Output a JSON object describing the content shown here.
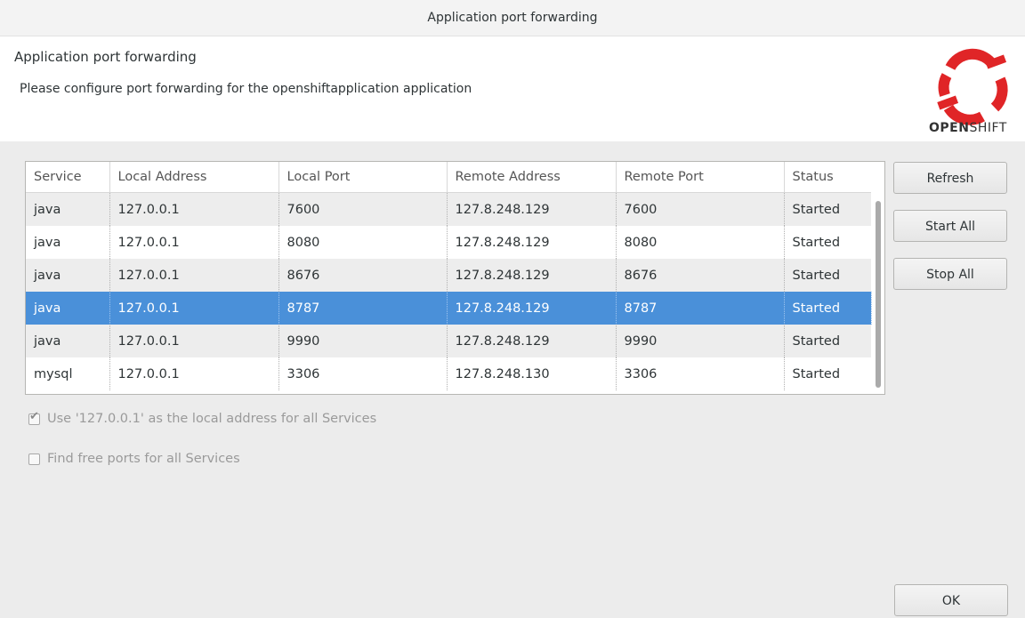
{
  "window": {
    "title": "Application port forwarding"
  },
  "banner": {
    "title": "Application port forwarding",
    "description": "Please configure port forwarding for the openshiftapplication application",
    "logo_text_bold": "OPEN",
    "logo_text_light": "SHIFT",
    "logo_color": "#e02527"
  },
  "table": {
    "headers": [
      "Service",
      "Local Address",
      "Local Port",
      "Remote Address",
      "Remote Port",
      "Status"
    ],
    "rows": [
      [
        "java",
        "127.0.0.1",
        "7600",
        "127.8.248.129",
        "7600",
        "Started"
      ],
      [
        "java",
        "127.0.0.1",
        "8080",
        "127.8.248.129",
        "8080",
        "Started"
      ],
      [
        "java",
        "127.0.0.1",
        "8676",
        "127.8.248.129",
        "8676",
        "Started"
      ],
      [
        "java",
        "127.0.0.1",
        "8787",
        "127.8.248.129",
        "8787",
        "Started"
      ],
      [
        "java",
        "127.0.0.1",
        "9990",
        "127.8.248.129",
        "9990",
        "Started"
      ],
      [
        "mysql",
        "127.0.0.1",
        "3306",
        "127.8.248.130",
        "3306",
        "Started"
      ]
    ],
    "selected_row": 3,
    "selection_color": "#4a90d9"
  },
  "buttons": {
    "refresh": "Refresh",
    "start_all": "Start All",
    "stop_all": "Stop All",
    "ok": "OK"
  },
  "options": {
    "use_local_address": {
      "label": "Use '127.0.0.1' as the local address for all Services",
      "checked": true
    },
    "find_free_ports": {
      "label": "Find free ports for all Services",
      "checked": false
    }
  }
}
